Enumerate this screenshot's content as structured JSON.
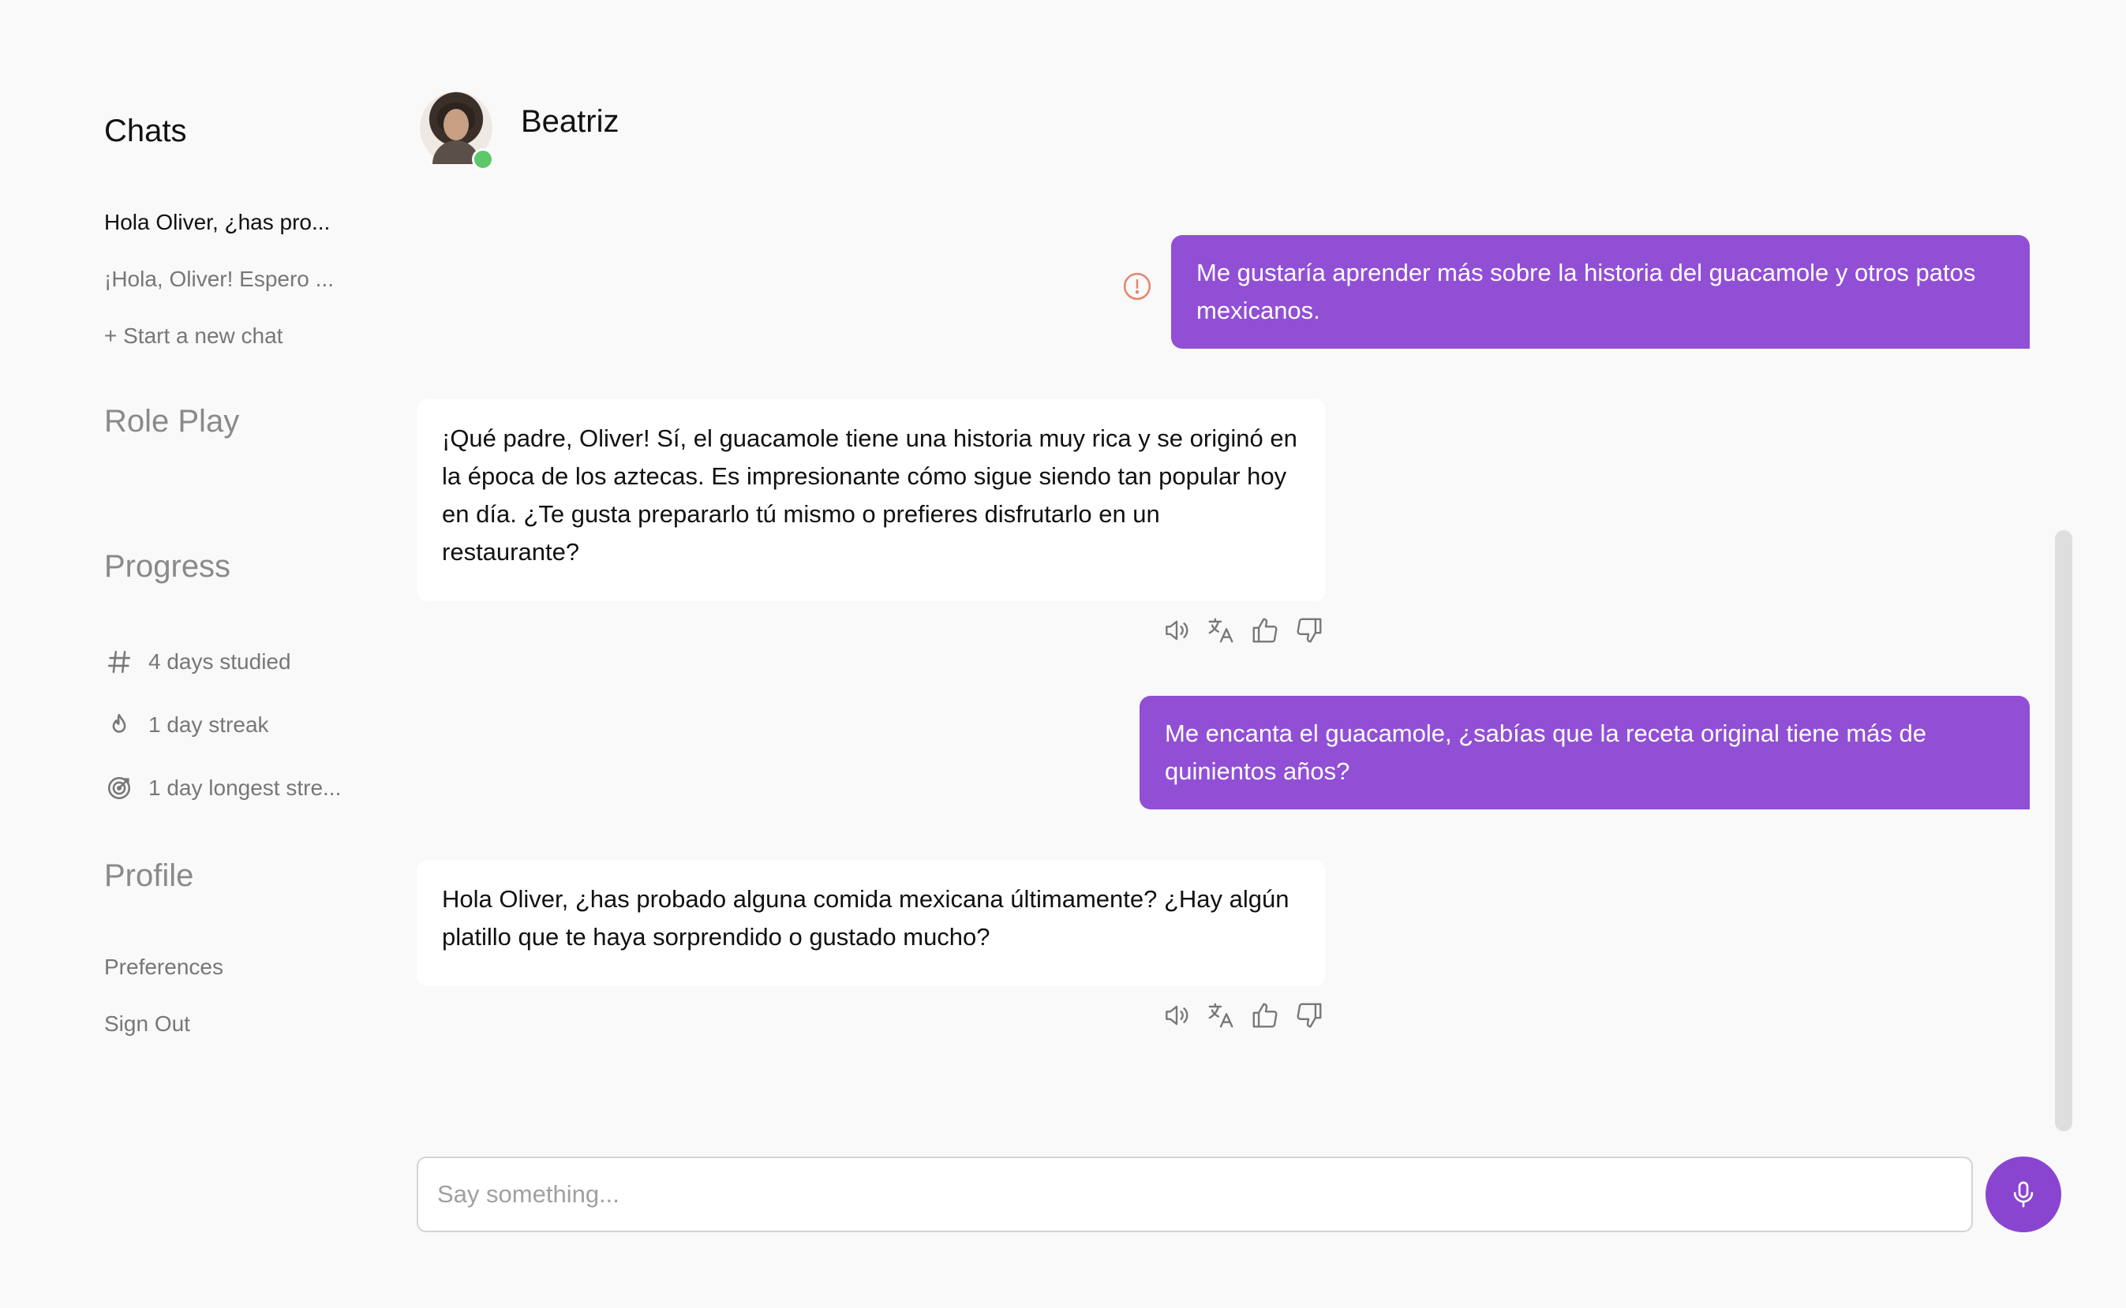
{
  "sidebar": {
    "chats_heading": "Chats",
    "chats": [
      {
        "label": "Hola Oliver, ¿has pro...",
        "active": true
      },
      {
        "label": "¡Hola, Oliver! Espero ..."
      },
      {
        "label": "+ Start a new chat"
      }
    ],
    "roleplay_heading": "Role Play",
    "progress_heading": "Progress",
    "progress": [
      {
        "icon": "hash-icon",
        "label": "4 days studied"
      },
      {
        "icon": "flame-icon",
        "label": "1 day streak"
      },
      {
        "icon": "target-icon",
        "label": "1 day longest stre..."
      }
    ],
    "profile_heading": "Profile",
    "profile": [
      {
        "label": "Preferences"
      },
      {
        "label": "Sign Out"
      }
    ]
  },
  "header": {
    "contact_name": "Beatriz",
    "online": true
  },
  "messages": [
    {
      "from": "user",
      "text": "Me gustaría aprender más sobre la historia del guacamole y otros patos mexicanos.",
      "warning": true
    },
    {
      "from": "bot",
      "text": "¡Qué padre, Oliver! Sí, el guacamole tiene una historia muy rica y se originó en la época de los aztecas. Es impresionante cómo sigue siendo tan popular hoy en día. ¿Te gusta prepararlo tú mismo o prefieres disfrutarlo en un restaurante?"
    },
    {
      "from": "user",
      "text": "Me encanta el guacamole, ¿sabías que la receta original tiene más de quinientos años?"
    },
    {
      "from": "bot",
      "text": "Hola Oliver, ¿has probado alguna comida mexicana últimamente? ¿Hay algún platillo que te haya sorprendido o gustado mucho?"
    }
  ],
  "message_actions": [
    "speaker-icon",
    "translate-icon",
    "thumbs-up-icon",
    "thumbs-down-icon"
  ],
  "composer": {
    "placeholder": "Say something...",
    "mic_icon": "microphone-icon"
  },
  "colors": {
    "accent": "#914fd5",
    "online": "#5cc86a",
    "warning": "#e8846a",
    "background": "#f9f9f9"
  }
}
